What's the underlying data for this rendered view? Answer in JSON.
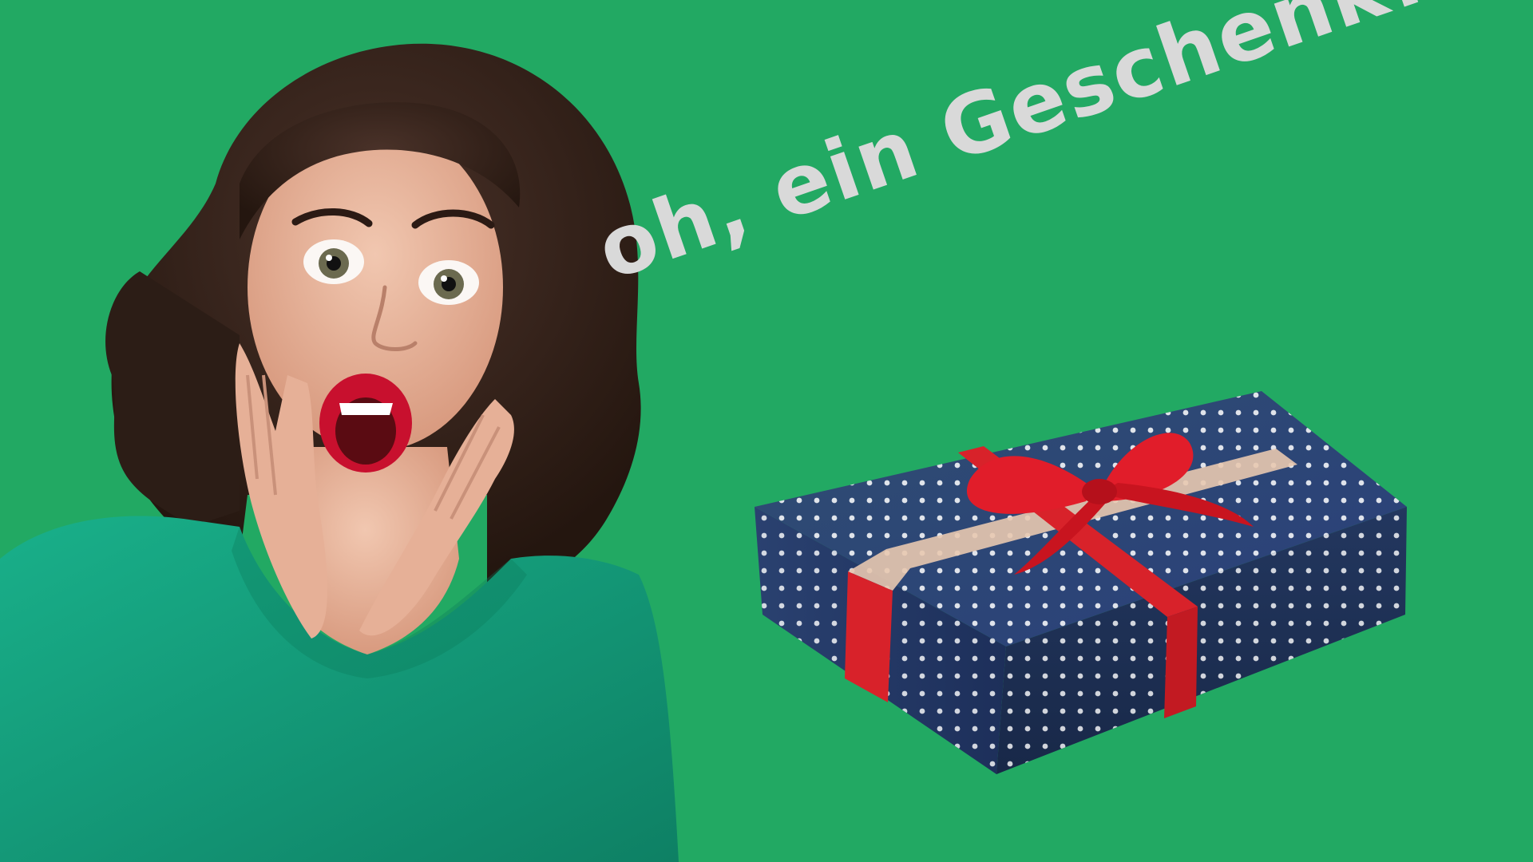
{
  "scene": {
    "background_color": "#22a963",
    "headline": "oh, ein Geschenk!!!",
    "headline_color": "#d9d9d9",
    "subjects": {
      "person": "surprised-woman",
      "object": "gift-box"
    },
    "colors": {
      "sweater": "#16a07a",
      "hair": "#3a2620",
      "lips": "#c8102e",
      "gift_paper": "#1f3360",
      "polka_dots": "#ffffff",
      "ribbon": "#d8222a"
    }
  }
}
